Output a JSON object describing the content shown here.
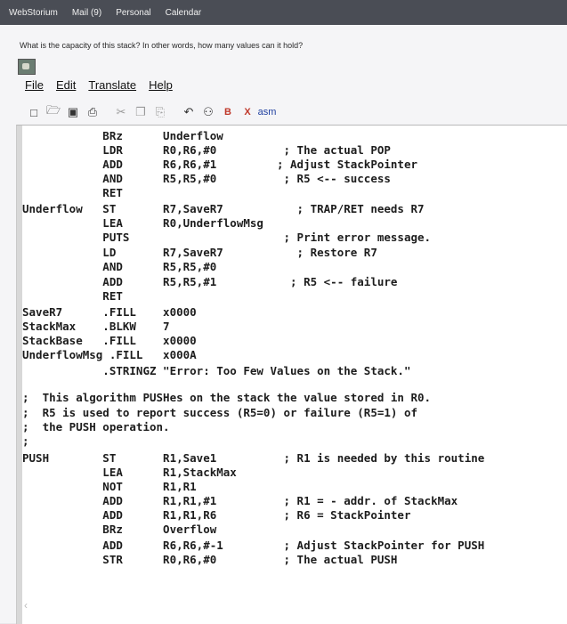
{
  "browser_nav": [
    "WebStorium",
    "Mail (9)",
    "Personal",
    "Calendar"
  ],
  "question": "What is the capacity of this stack? In other words, how many values can it hold?",
  "menu": [
    "File",
    "Edit",
    "Translate",
    "Help"
  ],
  "toolbar_icons": [
    "new-file-icon",
    "open-folder-icon",
    "save-icon",
    "print-icon",
    "cut-icon",
    "copy-icon",
    "paste-icon",
    "undo-icon",
    "find-icon",
    "build-b-icon",
    "build-x-icon",
    "build-asm-icon"
  ],
  "code_lines": [
    "            BRz      Underflow",
    "            LDR      R0,R6,#0          ; The actual POP",
    "            ADD      R6,R6,#1         ; Adjust StackPointer",
    "            AND      R5,R5,#0          ; R5 <-- success",
    "            RET",
    "Underflow   ST       R7,SaveR7           ; TRAP/RET needs R7",
    "            LEA      R0,UnderflowMsg",
    "            PUTS                       ; Print error message.",
    "            LD       R7,SaveR7           ; Restore R7",
    "            AND      R5,R5,#0",
    "            ADD      R5,R5,#1           ; R5 <-- failure",
    "            RET",
    "SaveR7      .FILL    x0000",
    "StackMax    .BLKW    7",
    "StackBase   .FILL    x0000",
    "UnderflowMsg .FILL   x000A",
    "            .STRINGZ \"Error: Too Few Values on the Stack.\"",
    "",
    ";  This algorithm PUSHes on the stack the value stored in R0.",
    ";  R5 is used to report success (R5=0) or failure (R5=1) of",
    ";  the PUSH operation.",
    ";",
    "PUSH        ST       R1,Save1          ; R1 is needed by this routine",
    "            LEA      R1,StackMax",
    "            NOT      R1,R1",
    "            ADD      R1,R1,#1          ; R1 = - addr. of StackMax",
    "            ADD      R1,R1,R6          ; R6 = StackPointer",
    "            BRz      Overflow",
    "            ADD      R6,R6,#-1         ; Adjust StackPointer for PUSH",
    "            STR      R0,R6,#0          ; The actual PUSH"
  ]
}
